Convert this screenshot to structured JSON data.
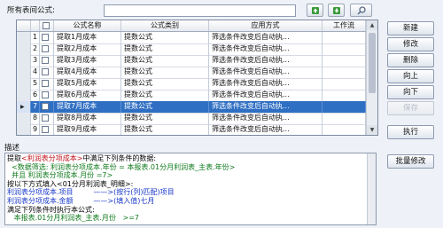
{
  "header": {
    "all_formulas_label": "所有表间公式:",
    "search_value": ""
  },
  "toolbar": {
    "up_icon": "arrow-up-icon",
    "down_icon": "arrow-down-icon",
    "search_icon": "search-icon"
  },
  "grid": {
    "columns": [
      "",
      "公式名称",
      "公式类别",
      "应用方式",
      "工作流"
    ],
    "rows": [
      {
        "no": "1",
        "name": "提取1月成本",
        "type": "提数公式",
        "apply": "筛选条件改变后自动执...",
        "selected": false
      },
      {
        "no": "2",
        "name": "提取2月成本",
        "type": "提数公式",
        "apply": "筛选条件改变后自动执...",
        "selected": false
      },
      {
        "no": "3",
        "name": "提取3月成本",
        "type": "提数公式",
        "apply": "筛选条件改变后自动执...",
        "selected": false
      },
      {
        "no": "4",
        "name": "提取4月成本",
        "type": "提数公式",
        "apply": "筛选条件改变后自动执...",
        "selected": false
      },
      {
        "no": "5",
        "name": "提取5月成本",
        "type": "提数公式",
        "apply": "筛选条件改变后自动执...",
        "selected": false
      },
      {
        "no": "6",
        "name": "提取6月成本",
        "type": "提数公式",
        "apply": "筛选条件改变后自动执...",
        "selected": false
      },
      {
        "no": "7",
        "name": "提取7月成本",
        "type": "提数公式",
        "apply": "筛选条件改变后自动执...",
        "selected": true
      },
      {
        "no": "8",
        "name": "提取8月成本",
        "type": "提数公式",
        "apply": "筛选条件改变后自动执...",
        "selected": false
      },
      {
        "no": "9",
        "name": "提取9月成本",
        "type": "提数公式",
        "apply": "筛选条件改变后自动执...",
        "selected": false
      }
    ]
  },
  "side_buttons": {
    "new": "新建",
    "edit": "修改",
    "delete": "删除",
    "up": "向上",
    "down": "向下",
    "save": "保存",
    "execute": "执行",
    "batch_edit": "批量修改"
  },
  "description": {
    "label": "描述",
    "lines": [
      [
        {
          "t": "提取",
          "c": "k"
        },
        {
          "t": "<利润表分项成本>",
          "c": "r"
        },
        {
          "t": "中满足下列条件的数据:",
          "c": "k"
        }
      ],
      [
        {
          "t": "  <数据筛选: 利润表分项成本.年份 = 本报表.01分月利润表_主表.年份>",
          "c": "g"
        }
      ],
      [
        {
          "t": "  并且 利润表分项成本.月份 =7>",
          "c": "g"
        }
      ],
      [
        {
          "t": "按以下方式填入<01分月利润表_明细>:",
          "c": "k"
        }
      ],
      [
        {
          "t": "利润表分项成本.项目         ——>(按行(列)匹配)项目",
          "c": "b"
        }
      ],
      [
        {
          "t": "利润表分项成本.金额         ——>(填入值)七月",
          "c": "b"
        }
      ],
      [
        {
          "t": "满足下列条件时执行本公式:",
          "c": "k"
        }
      ],
      [
        {
          "t": "   本报表.01分月利润表_主表.月份   >=7",
          "c": "g"
        }
      ]
    ]
  }
}
